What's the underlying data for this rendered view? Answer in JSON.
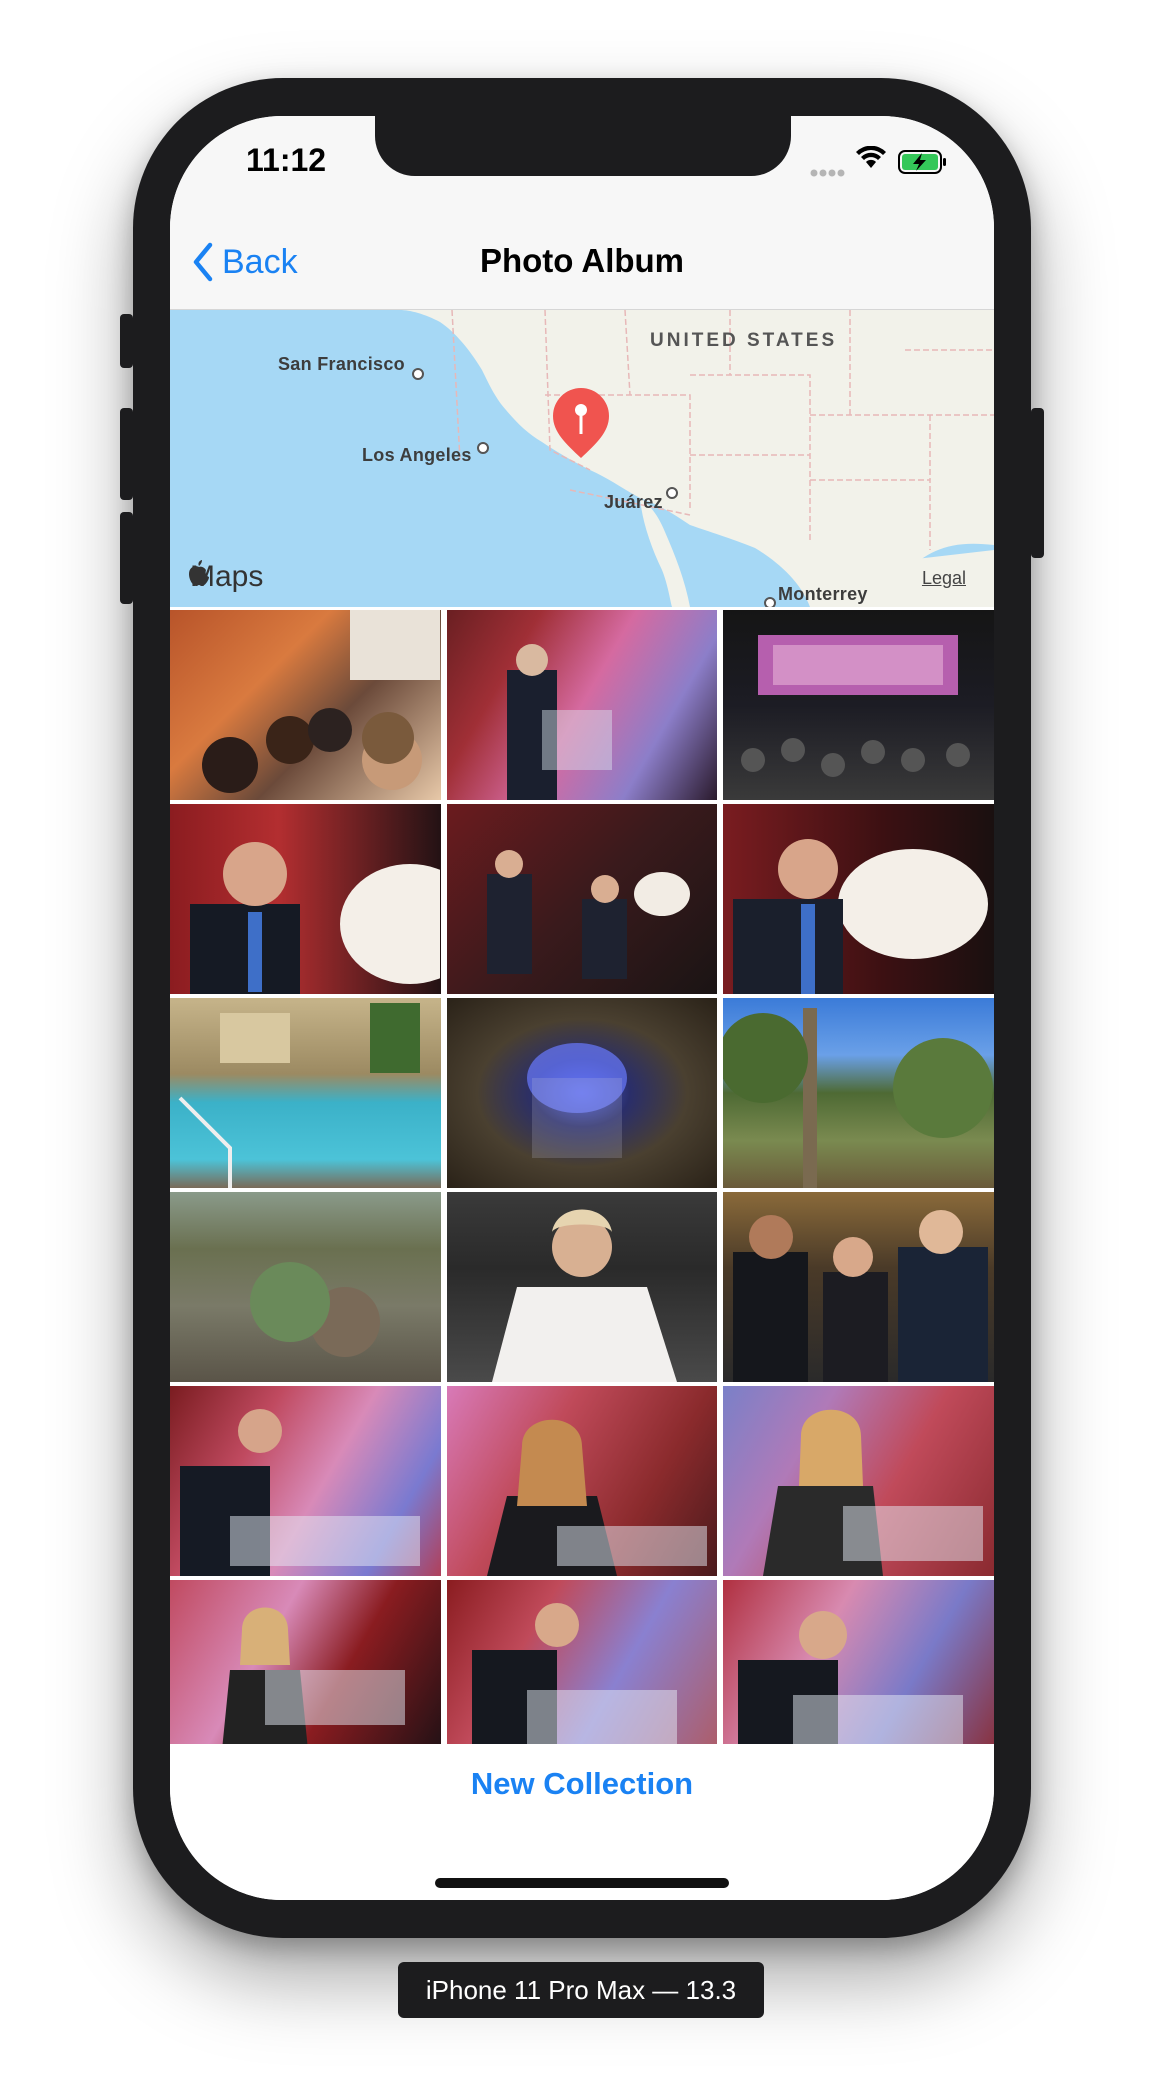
{
  "status_bar": {
    "time": "11:12"
  },
  "nav": {
    "back_label": "Back",
    "title": "Photo Album"
  },
  "map": {
    "country_label": "UNITED STATES",
    "cities": [
      "San Francisco",
      "Los Angeles",
      "Juárez",
      "Monterrey"
    ],
    "attribution": "Maps",
    "legal": "Legal"
  },
  "photos": [
    "Group selfie in restaurant",
    "Speaker at podium",
    "Arizona Chamber banquet hall",
    "Man speaking with microphone",
    "Two men seated on stage",
    "Man with microphone at event",
    "Swimming pool",
    "Flaming shot glass",
    "Trees and building",
    "Desert hillside with cactus",
    "Woman in white jacket",
    "Three people posing",
    "Speaker at podium",
    "Woman speaking at podium",
    "Woman speaking at podium",
    "Woman at podium",
    "Man speaking at podium",
    "Man speaking at podium"
  ],
  "footer": {
    "action_label": "New Collection"
  },
  "device": {
    "label": "iPhone 11 Pro Max — 13.3"
  },
  "colors": {
    "accent": "#1a82f3",
    "pin": "#f0544f"
  }
}
